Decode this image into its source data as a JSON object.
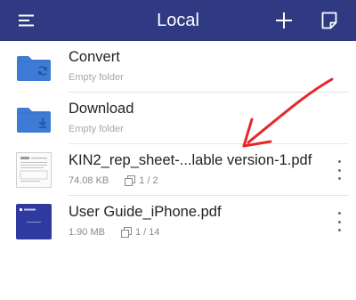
{
  "header": {
    "title": "Local",
    "menu_icon": "hamburger-menu-icon",
    "add_icon": "plus-icon",
    "edit_icon": "note-edit-icon",
    "background": "#2f3a83"
  },
  "files": [
    {
      "name": "Convert",
      "subtitle": "Empty folder",
      "kind": "folder",
      "icon": "folder-convert-icon"
    },
    {
      "name": "Download",
      "subtitle": "Empty folder",
      "kind": "folder",
      "icon": "folder-download-icon"
    },
    {
      "name": "KIN2_rep_sheet-...lable version-1.pdf",
      "size": "74.08 KB",
      "pages": "1 / 2",
      "kind": "pdf"
    },
    {
      "name": "User Guide_iPhone.pdf",
      "size": "1.90 MB",
      "pages": "1 / 14",
      "kind": "pdf",
      "thumb_label": "pdfelement"
    }
  ],
  "colors": {
    "folder": "#3e7bd6",
    "annotation_arrow": "#e8262a",
    "accent": "#2f3a83"
  }
}
